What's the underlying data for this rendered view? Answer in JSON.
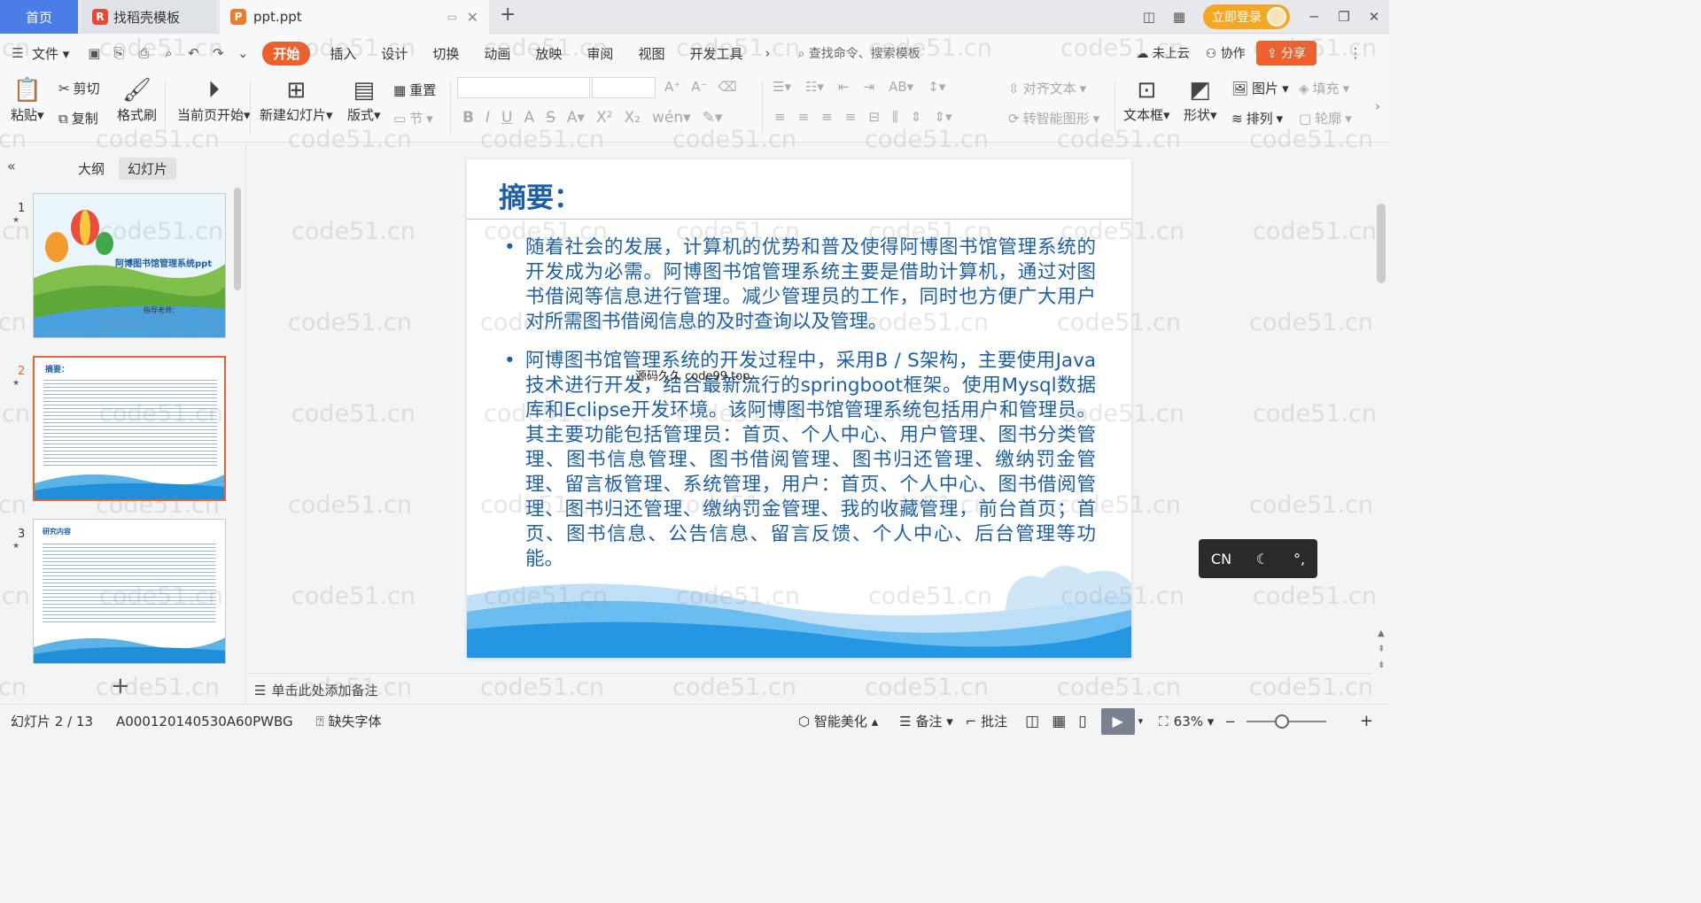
{
  "tabs": {
    "home": "首页",
    "template": "找稻壳模板",
    "file": "ppt.ppt",
    "login": "立即登录"
  },
  "menu": {
    "file": "文件",
    "items": [
      "开始",
      "插入",
      "设计",
      "切换",
      "动画",
      "放映",
      "审阅",
      "视图",
      "开发工具"
    ],
    "active": "开始",
    "search": "查找命令、搜索模板",
    "cloud": "未上云",
    "collab": "协作",
    "share": "分享"
  },
  "toolbar": {
    "paste": "粘贴",
    "cut": "剪切",
    "copy": "复制",
    "format_painter": "格式刷",
    "from_current": "当前页开始",
    "new_slide": "新建幻灯片",
    "layout": "版式",
    "section": "节",
    "reset": "重置",
    "align_text": "对齐文本",
    "smart_shape": "转智能图形",
    "textbox": "文本框",
    "shape": "形状",
    "picture": "图片",
    "arrange": "排列",
    "fill": "填充",
    "outline": "轮廓"
  },
  "sidebar": {
    "outline_tab": "大纲",
    "slides_tab": "幻灯片",
    "slides": [
      {
        "num": "1",
        "title": "阿博图书馆管理系统ppt",
        "sub": "指导老师："
      },
      {
        "num": "2",
        "title": "摘要："
      },
      {
        "num": "3",
        "title": "研究内容"
      }
    ]
  },
  "slide": {
    "title": "摘要：",
    "bullets": [
      " 随着社会的发展，计算机的优势和普及使得阿博图书馆管理系统的开发成为必需。阿博图书馆管理系统主要是借助计算机，通过对图书借阅等信息进行管理。减少管理员的工作，同时也方便广大用户对所需图书借阅信息的及时查询以及管理。",
      "阿博图书馆管理系统的开发过程中，采用B / S架构，主要使用Java技术进行开发，结合最新流行的springboot框架。使用Mysql数据库和Eclipse开发环境。该阿博图书馆管理系统包括用户和管理员。其主要功能包括管理员：首页、个人中心、用户管理、图书分类管理、图书信息管理、图书借阅管理、图书归还管理、缴纳罚金管理、留言板管理、系统管理，用户：首页、个人中心、图书借阅管理、图书归还管理、缴纳罚金管理、我的收藏管理，前台首页；首页、图书信息、公告信息、留言反馈、个人中心、后台管理等功能。"
    ],
    "overlay": "源码久久 code99.top"
  },
  "notes": "单击此处添加备注",
  "ime": {
    "lang": "CN"
  },
  "status": {
    "slide_pos": "幻灯片 2 / 13",
    "doc_id": "A000120140530A60PWBG",
    "missing_font": "缺失字体",
    "beautify": "智能美化",
    "notes": "备注",
    "comment": "批注",
    "zoom": "63%"
  },
  "watermark": "code51.cn"
}
